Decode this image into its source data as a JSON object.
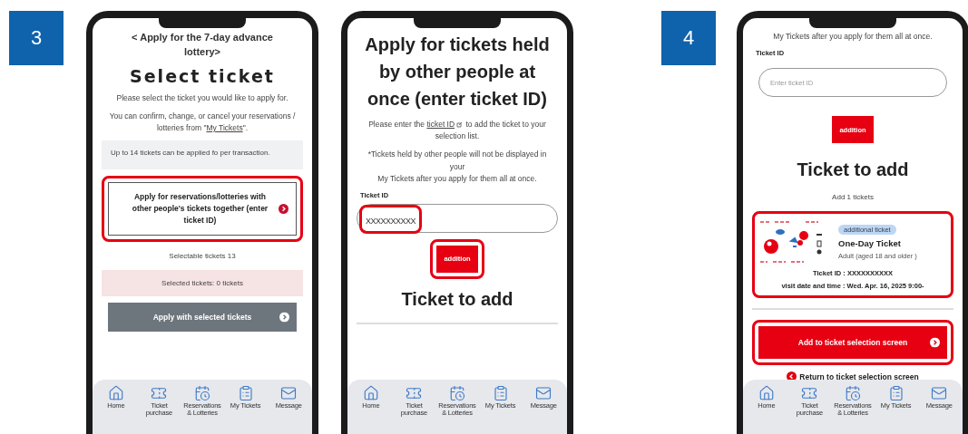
{
  "steps": [
    {
      "badge": "3",
      "screens": [
        {
          "blocks": [
            {
              "kind": "back_header",
              "text": "< Apply for the 7-day advance lottery>"
            },
            {
              "kind": "page_title",
              "text": "Select ticket"
            },
            {
              "kind": "paragraph",
              "text": "Please select the ticket you would like to apply for."
            },
            {
              "kind": "link_paragraph",
              "before": "You can confirm, change, or cancel your reservations / lotteries from \"",
              "link": "My Tickets",
              "after": "\".",
              "external": false
            },
            {
              "kind": "note",
              "text": "Up to 14 tickets can be applied fo per transaction."
            },
            {
              "kind": "option_button",
              "text": "Apply for reservations/lotteries with other people's tickets together (enter ticket ID)",
              "highlighted": true
            },
            {
              "kind": "caption",
              "text": "Selectable tickets 13"
            },
            {
              "kind": "status_bar",
              "text": "Selected tickets: 0 tickets"
            },
            {
              "kind": "action_button",
              "text": "Apply with selected tickets",
              "disabled": true,
              "highlighted": false
            }
          ],
          "nav": [
            "Home",
            "Ticket purchase",
            "Reservations & Lotteries",
            "My Tickets",
            "Message"
          ]
        },
        {
          "blocks": [
            {
              "kind": "title",
              "text": "Apply for tickets held by other people at once (enter ticket ID)"
            },
            {
              "kind": "link_paragraph",
              "before": "Please enter the ",
              "link": "ticket ID",
              "after": " to add the ticket to your selection list.",
              "external": true
            },
            {
              "kind": "paragraph",
              "text": "*Tickets held by other people will not be displayed in your\nMy Tickets after you apply for them all at once."
            },
            {
              "kind": "field",
              "label": "Ticket ID",
              "value": "XXXXXXXXXX",
              "highlighted": true
            },
            {
              "kind": "add_button",
              "text": "addition",
              "highlighted": true
            },
            {
              "kind": "title",
              "text": "Ticket to add"
            },
            {
              "kind": "divider"
            }
          ],
          "nav": [
            "Home",
            "Ticket purchase",
            "Reservations & Lotteries",
            "My Tickets",
            "Message"
          ]
        }
      ]
    },
    {
      "badge": "4",
      "screens": [
        {
          "blocks": [
            {
              "kind": "paragraph",
              "text": "My Tickets after you apply for them all at once."
            },
            {
              "kind": "field",
              "label": "Ticket ID",
              "placeholder": "Enter ticket ID",
              "highlighted": false
            },
            {
              "kind": "add_button",
              "text": "addition",
              "highlighted": false
            },
            {
              "kind": "title",
              "text": "Ticket to add"
            },
            {
              "kind": "caption",
              "text": "Add 1 tickets"
            },
            {
              "kind": "ticket_card",
              "tag": "additional ticket",
              "name": "One-Day Ticket",
              "detail": "Adult (aged 18 and older )",
              "rows": [
                {
                  "label": "Ticket ID :",
                  "value": "XXXXXXXXXX"
                },
                {
                  "label": "visit date and time :",
                  "value": "Wed. Apr. 16, 2025 9:00-"
                }
              ],
              "highlighted": true
            },
            {
              "kind": "divider"
            },
            {
              "kind": "action_button",
              "text": "Add to ticket selection screen",
              "disabled": false,
              "highlighted": true
            },
            {
              "kind": "back_link",
              "text": "Return to ticket selection screen"
            }
          ],
          "nav": [
            "Home",
            "Ticket purchase",
            "Reservations & Lotteries",
            "My Tickets",
            "Message"
          ]
        }
      ]
    }
  ]
}
